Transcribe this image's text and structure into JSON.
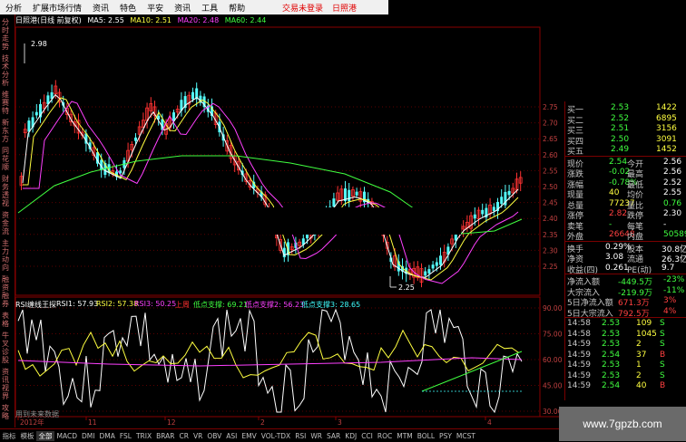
{
  "menu": {
    "items": [
      "分析",
      "扩展市场行情",
      "资讯",
      "特色",
      "平安",
      "资讯",
      "工具",
      "帮助"
    ],
    "login": "交易未登录",
    "stock": "日照港"
  },
  "left_tabs": [
    "分时走势",
    "技术分析",
    "维赛特",
    "新东方",
    "同花顺",
    "财务透视",
    "资金流",
    "主力动向",
    "融资融券",
    "表格",
    "牛叉诊股",
    "资讯视界",
    "攻略"
  ],
  "title": {
    "name": "日照港(日线 前复权)",
    "ma5": "MA5: 2.55",
    "ma10": "MA10: 2.51",
    "ma20": "MA20: 2.48",
    "ma60": "MA60: 2.44"
  },
  "price_axis": [
    "2.75",
    "2.70",
    "2.65",
    "2.60",
    "2.55",
    "2.50",
    "2.45",
    "2.40",
    "2.35",
    "2.30",
    "2.25"
  ],
  "annotations": {
    "high": "2.98",
    "low": "2.25"
  },
  "rsi": {
    "name": "RSI缠线王探",
    "rsi1": "RSI1: 57.93",
    "rsi2": "RSI2: 57.38",
    "rsi3": "RSI3: 50.25",
    "up": "上周",
    "s1": "低点支撑: 69.21",
    "s2": "低点支撑2: 56.23",
    "s3": "低点支撑3: 28.65",
    "axis": [
      "90.00",
      "75.00",
      "60.00",
      "45.00",
      "30.00"
    ],
    "note": "用到未来数据"
  },
  "xaxis": [
    "2012年",
    "11",
    "12",
    "2",
    "3",
    "4"
  ],
  "bottom_tabs": [
    "指标",
    "模板",
    "全部",
    "MACD",
    "DMI",
    "DMA",
    "FSL",
    "TRIX",
    "BRAR",
    "CR",
    "VR",
    "OBV",
    "ASI",
    "EMV",
    "VOL-TDX",
    "RSI",
    "WR",
    "SAR",
    "KDJ",
    "CCI",
    "ROC",
    "MTM",
    "BOLL",
    "PSY",
    "MCST"
  ],
  "quote": {
    "asks": [
      {
        "label": "买一",
        "price": "2.53",
        "vol": "1422"
      },
      {
        "label": "买二",
        "price": "2.52",
        "vol": "6895"
      },
      {
        "label": "买三",
        "price": "2.51",
        "vol": "3156"
      },
      {
        "label": "买四",
        "price": "2.50",
        "vol": "3091"
      },
      {
        "label": "买五",
        "price": "2.49",
        "vol": "1452"
      }
    ],
    "stats": [
      {
        "l1": "现价",
        "v1": "2.54",
        "l2": "今开",
        "v2": "2.56"
      },
      {
        "l1": "涨跌",
        "v1": "-0.02",
        "l2": "最高",
        "v2": "2.56"
      },
      {
        "l1": "涨幅",
        "v1": "-0.78%",
        "l2": "最低",
        "v2": "2.52"
      },
      {
        "l1": "现量",
        "v1": "40",
        "l2": "均价",
        "v2": "2.55"
      },
      {
        "l1": "总量",
        "v1": "77237",
        "l2": "量比",
        "v2": "0.76"
      },
      {
        "l1": "涨停",
        "v1": "2.82",
        "l2": "跌停",
        "v2": "2.30"
      },
      {
        "l1": "卖笔",
        "v1": "-",
        "l2": "每笔",
        "v2": "-"
      },
      {
        "l1": "外盘",
        "v1": "26648",
        "l2": "内盘",
        "v2": "50589"
      }
    ],
    "fund": [
      {
        "l1": "换手",
        "v1": "0.29%",
        "l2": "股本",
        "v2": "30.8亿"
      },
      {
        "l1": "净资",
        "v1": "3.08",
        "l2": "流通",
        "v2": "26.3亿"
      },
      {
        "l1": "收益(四)",
        "v1": "0.261",
        "l2": "PE(动)",
        "v2": "9.7"
      }
    ],
    "flow": [
      {
        "l": "净流入额",
        "v": "-449.5万",
        "p": "-23%"
      },
      {
        "l": "大宗流入",
        "v": "-219.9万",
        "p": "-11%"
      },
      {
        "l": "5日净流入额",
        "v": "671.3万",
        "p": "3%"
      },
      {
        "l": "5日大宗流入",
        "v": "792.5万",
        "p": "4%"
      }
    ],
    "ticks": [
      {
        "t": "14:58",
        "p": "2.53",
        "v": "109",
        "d": "S"
      },
      {
        "t": "14:58",
        "p": "2.53",
        "v": "1045",
        "d": "S"
      },
      {
        "t": "14:59",
        "p": "2.53",
        "v": "2",
        "d": "S"
      },
      {
        "t": "14:59",
        "p": "2.54",
        "v": "37",
        "d": "B"
      },
      {
        "t": "14:59",
        "p": "2.53",
        "v": "1",
        "d": "S"
      },
      {
        "t": "14:59",
        "p": "2.53",
        "v": "2",
        "d": "S"
      },
      {
        "t": "14:59",
        "p": "2.54",
        "v": "40",
        "d": "B"
      }
    ]
  },
  "watermark": "www.7gpzb.com"
}
